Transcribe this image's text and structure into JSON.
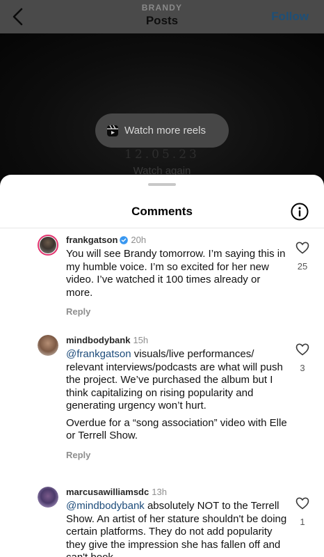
{
  "header": {
    "subtitle": "BRANDY",
    "title": "Posts",
    "follow_label": "Follow"
  },
  "video": {
    "reels_button_label": "Watch more reels",
    "date_text": "12.05.23",
    "watch_again_label": "Watch again"
  },
  "comments_sheet": {
    "title": "Comments",
    "comments": [
      {
        "username": "frankgatson",
        "verified": true,
        "time": "20h",
        "paragraphs": [
          "You will see Brandy tomorrow. I’m saying this in my humble voice.  I’m so excited for her new video.  I’ve watched it 100 times already or more."
        ],
        "mention": "",
        "reply_label": "Reply",
        "like_count": "25"
      },
      {
        "username": "mindbodybank",
        "verified": false,
        "time": "15h",
        "mention": "@frankgatson",
        "paragraphs": [
          "visuals/live performances/ relevant interviews/podcasts are what will push the project. We’ve purchased the album but I think capitalizing on rising popularity and generating urgency won’t hurt.",
          "Overdue for a “song association” video with Elle or Terrell Show."
        ],
        "reply_label": "Reply",
        "like_count": "3"
      },
      {
        "username": "marcusawilliamsdc",
        "verified": false,
        "time": "13h",
        "mention": "@mindbodybank",
        "paragraphs": [
          "absolutely NOT to the Terrell Show. An artist of her stature shouldn't be doing certain platforms. They do not add popularity they give the impression she has fallen off and can't book"
        ],
        "reply_label": "",
        "like_count": "1"
      }
    ]
  },
  "icons": {
    "back": "chevron-left-icon",
    "reels": "reels-icon",
    "info": "info-icon",
    "like": "heart-outline-icon",
    "verified": "verified-badge-icon"
  },
  "colors": {
    "follow": "#1e4f77",
    "mention": "#1c4b7a",
    "verified": "#3897f0",
    "story_ring": "#e1306c"
  }
}
